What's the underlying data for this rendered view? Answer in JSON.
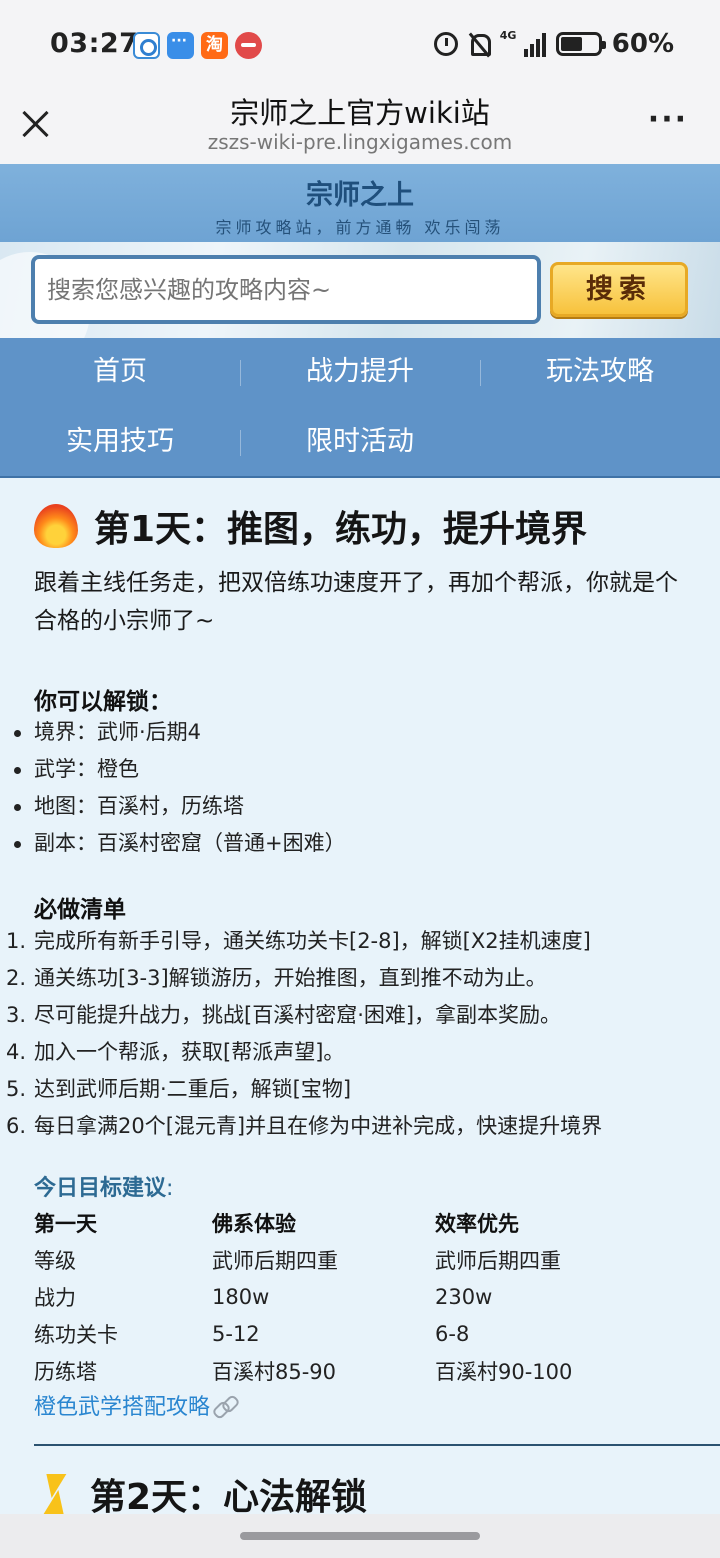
{
  "status_bar": {
    "time": "03:27",
    "notification_app_3": "淘",
    "network": "4G",
    "battery": "60%"
  },
  "browser": {
    "title": "宗师之上官方wiki站",
    "url": "zszs-wiki-pre.lingxigames.com",
    "more": "···"
  },
  "site": {
    "name": "宗师之上",
    "slogan": "宗师攻略站，前方通畅 欢乐闯荡"
  },
  "search": {
    "placeholder": "搜索您感兴趣的攻略内容~",
    "button": "搜索"
  },
  "nav": {
    "items": [
      {
        "label": "首页"
      },
      {
        "label": "战力提升"
      },
      {
        "label": "玩法攻略"
      },
      {
        "label": "实用技巧"
      },
      {
        "label": "限时活动"
      }
    ]
  },
  "day1": {
    "heading": "第1天：推图，练功，提升境界",
    "intro": "跟着主线任务走，把双倍练功速度开了，再加个帮派，你就是个合格的小宗师了~",
    "unlock_title": "你可以解锁：",
    "unlocks": [
      "境界：武师·后期4",
      "武学：橙色",
      "地图：百溪村，历练塔",
      "副本：百溪村密窟（普通+困难）"
    ],
    "checklist_title": "必做清单",
    "checklist": [
      {
        "num": "1.",
        "text": "完成所有新手引导，通关练功关卡[2-8]，解锁[X2挂机速度]"
      },
      {
        "num": "2.",
        "text": "通关练功[3-3]解锁游历，开始推图，直到推不动为止。"
      },
      {
        "num": "3.",
        "text": "尽可能提升战力，挑战[百溪村密窟·困难]，拿副本奖励。"
      },
      {
        "num": "4.",
        "text": "加入一个帮派，获取[帮派声望]。"
      },
      {
        "num": "5.",
        "text": "达到武师后期·二重后，解锁[宝物]"
      },
      {
        "num": "6.",
        "text": "每日拿满20个[混元青]并且在修为中进补完成，快速提升境界"
      }
    ],
    "goal_title": "今日目标建议",
    "goal_colon": ":",
    "goal_table": {
      "headers": [
        "第一天",
        "佛系体验",
        "效率优先"
      ],
      "rows": [
        [
          "等级",
          "武师后期四重",
          "武师后期四重"
        ],
        [
          "战力",
          "180w",
          "230w"
        ],
        [
          "练功关卡",
          "5-12",
          "6-8"
        ],
        [
          "历练塔",
          "百溪村85-90",
          "百溪村90-100"
        ]
      ]
    },
    "link": "橙色武学搭配攻略"
  },
  "day2": {
    "heading": "第2天：心法解锁"
  },
  "colors": {
    "site_header": "#7fb1dc",
    "nav_bg": "#5f93c8",
    "page_bg": "#e8f3fa",
    "link": "#2a86d0",
    "search_button": "#f7c23c"
  }
}
